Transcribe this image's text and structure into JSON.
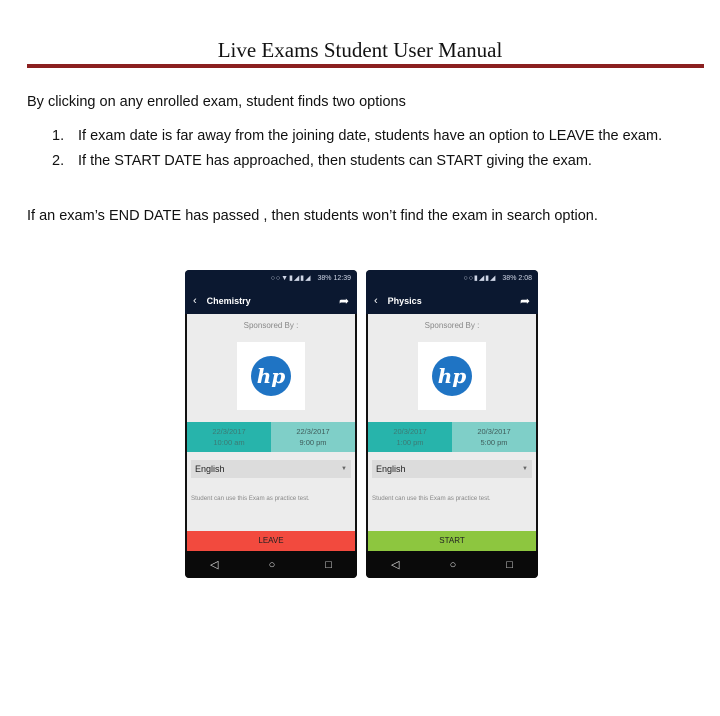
{
  "document": {
    "title": "Live Exams Student User Manual",
    "intro": "By clicking on any enrolled exam, student finds two options",
    "list": [
      {
        "num": "1.",
        "text": "If exam date is far away from the joining date, students have an option to LEAVE the exam."
      },
      {
        "num": "2.",
        "text": "If the START DATE has approached, then students can START giving the exam."
      }
    ],
    "outro": "If an exam’s END  DATE has passed , then students won’t find the exam in search option.",
    "rule_color": "#8b2020"
  },
  "phones": [
    {
      "time": "12:39",
      "battery": "38%",
      "subject": "Chemistry",
      "sponsored": "Sponsored By :",
      "logo_text": "hp",
      "start_date": "22/3/2017",
      "start_time": "10:00 am",
      "end_date": "22/3/2017",
      "end_time": "9:00 pm",
      "language": "English",
      "note": "Student can use this Exam as practice test.",
      "action": "LEAVE",
      "action_color": "#f24a3e"
    },
    {
      "time": "2:08",
      "battery": "38%",
      "subject": "Physics",
      "sponsored": "Sponsored By :",
      "logo_text": "hp",
      "start_date": "20/3/2017",
      "start_time": "1:00 pm",
      "end_date": "20/3/2017",
      "end_time": "5:00 pm",
      "language": "English",
      "note": "Student can use this Exam as practice test.",
      "action": "START",
      "action_color": "#8dc63f"
    }
  ],
  "icons": {
    "back": "chevron-left-icon",
    "share": "share-icon",
    "nav_back": "triangle-back-icon",
    "nav_home": "circle-home-icon",
    "nav_recent": "square-recent-icon"
  }
}
